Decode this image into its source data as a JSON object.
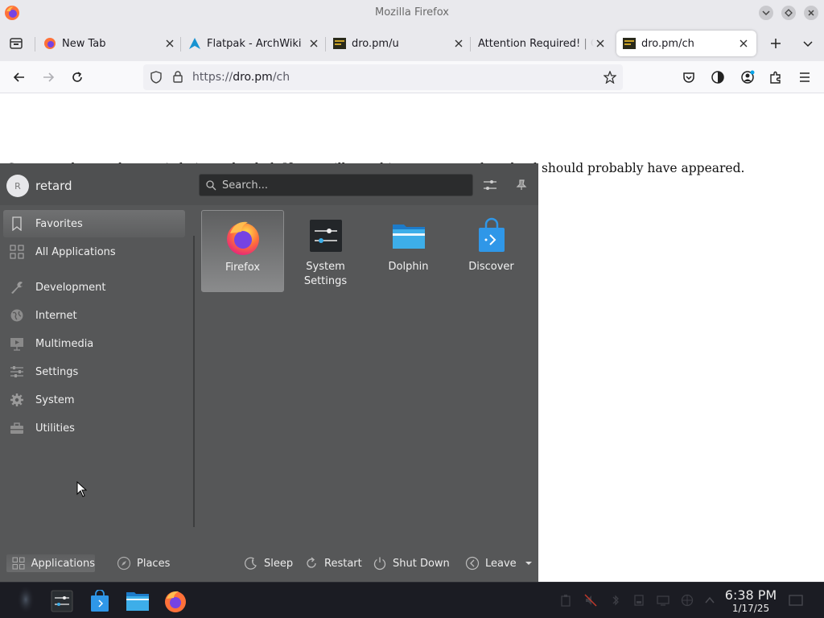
{
  "window": {
    "title": "Mozilla Firefox"
  },
  "tabs": [
    {
      "label": "New Tab",
      "active": false
    },
    {
      "label": "Flatpak - ArchWiki",
      "active": false
    },
    {
      "label": "dro.pm/u",
      "active": false
    },
    {
      "label": "Attention Required! | C",
      "active": false
    },
    {
      "label": "dro.pm/ch",
      "active": true
    }
  ],
  "navbar": {
    "url_scheme": "https://",
    "url_host": "dro.pm",
    "url_path": "/ch"
  },
  "page": {
    "message": "Contents detected, page is being reloaded. If you still see this message, a download should probably have appeared."
  },
  "launcher": {
    "user": {
      "initial": "R",
      "name": "retard"
    },
    "search_placeholder": "Search...",
    "categories": [
      {
        "label": "Favorites",
        "icon": "bookmark-icon",
        "selected": true
      },
      {
        "label": "All Applications",
        "icon": "grid-icon",
        "selected": false
      },
      {
        "label": "Development",
        "icon": "wrench-icon",
        "selected": false
      },
      {
        "label": "Internet",
        "icon": "globe-icon",
        "selected": false
      },
      {
        "label": "Multimedia",
        "icon": "monitor-icon",
        "selected": false
      },
      {
        "label": "Settings",
        "icon": "sliders-icon",
        "selected": false
      },
      {
        "label": "System",
        "icon": "gear-icon",
        "selected": false
      },
      {
        "label": "Utilities",
        "icon": "toolbox-icon",
        "selected": false
      }
    ],
    "favorites": [
      {
        "name": "Firefox",
        "icon": "firefox-icon",
        "selected": true
      },
      {
        "name": "System\nSettings",
        "name_line1": "System",
        "name_line2": "Settings",
        "icon": "system-settings-icon",
        "selected": false
      },
      {
        "name": "Dolphin",
        "icon": "folder-icon",
        "selected": false
      },
      {
        "name": "Discover",
        "icon": "store-bag-icon",
        "selected": false
      }
    ],
    "footer": {
      "applications": "Applications",
      "places": "Places",
      "sleep": "Sleep",
      "restart": "Restart",
      "shutdown": "Shut Down",
      "leave": "Leave"
    }
  },
  "taskbar": {
    "time": "6:38 PM",
    "date": "1/17/25"
  },
  "colors": {
    "launcher_bg": "#565758",
    "taskbar_bg": "#1b1c23",
    "firefox_orange": "#ff7139",
    "kde_blue": "#2f97e8"
  }
}
